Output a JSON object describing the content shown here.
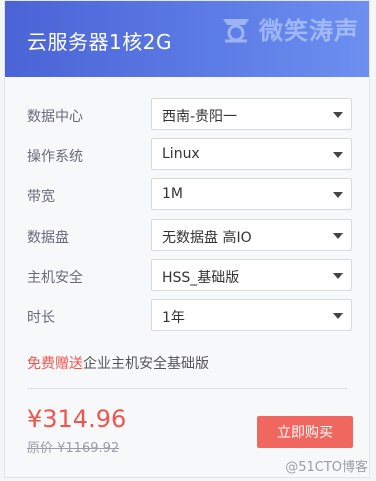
{
  "header": {
    "title": "云服务器1核2G",
    "watermark_text": "微笑涛声"
  },
  "config": {
    "rows": [
      {
        "label": "数据中心",
        "value": "西南-贵阳一"
      },
      {
        "label": "操作系统",
        "value": "Linux"
      },
      {
        "label": "带宽",
        "value": "1M"
      },
      {
        "label": "数据盘",
        "value": "无数据盘 高IO"
      },
      {
        "label": "主机安全",
        "value": "HSS_基础版"
      },
      {
        "label": "时长",
        "value": "1年"
      }
    ]
  },
  "promo": {
    "highlight": "免费赠送",
    "text": "企业主机安全基础版"
  },
  "pricing": {
    "price": "¥314.96",
    "original": "原价 ¥1169.92",
    "buy_label": "立即购买"
  },
  "footer": {
    "watermark": "@51CTO博客"
  },
  "colors": {
    "header_start": "#4b63d6",
    "header_end": "#6d8ff0",
    "accent_red": "#f0554d",
    "button": "#f0675f"
  }
}
